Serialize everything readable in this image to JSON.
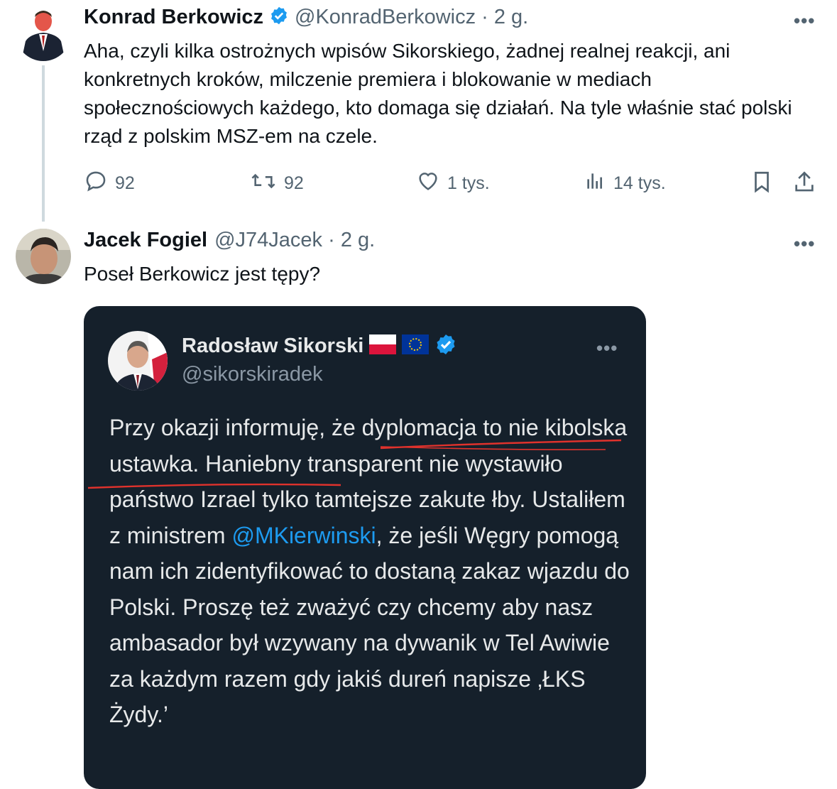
{
  "tweet1": {
    "name": "Konrad Berkowicz",
    "handle": "@KonradBerkowicz · 2 g.",
    "text": "Aha, czyli kilka ostrożnych wpisów Sikorskiego, żadnej realnej reakcji, ani konkretnych kroków, milczenie premiera i blokowanie w mediach społecznościowych każdego, kto domaga się działań. Na tyle właśnie stać polski rząd z polskim MSZ-em na czele.",
    "more": "•••",
    "replies": "92",
    "reposts": "92",
    "likes": "1 tys.",
    "views": "14 tys."
  },
  "tweet2": {
    "name": "Jacek Fogiel",
    "handle": "@J74Jacek · 2 g.",
    "text": "Poseł Berkowicz jest tępy?",
    "more": "•••"
  },
  "embedded": {
    "name": "Radosław Sikorski",
    "handle": "@sikorskiradek",
    "more": "•••",
    "text_part1": "Przy okazji informuję, że dyplomacja to nie kibolska ustawka. Haniebny transparent nie wystawiło państwo Izrael tylko tamtejsze zakute łby. Ustaliłem  z ministrem ",
    "mention": "@MKierwinski",
    "text_part2": ", że jeśli Węgry pomogą nam ich zidentyfikować to dostaną zakaz wjazdu do Polski.  Proszę też zważyć czy chcemy aby nasz ambasador był wzywany na dywanik w Tel Awiwie za każdym razem gdy jakiś dureń napisze ‚ŁKS Żydy.’"
  },
  "colors": {
    "verified": "#1d9bf0",
    "card_bg": "#15202b",
    "underline": "#e0322c",
    "secondary_text": "#536471"
  }
}
